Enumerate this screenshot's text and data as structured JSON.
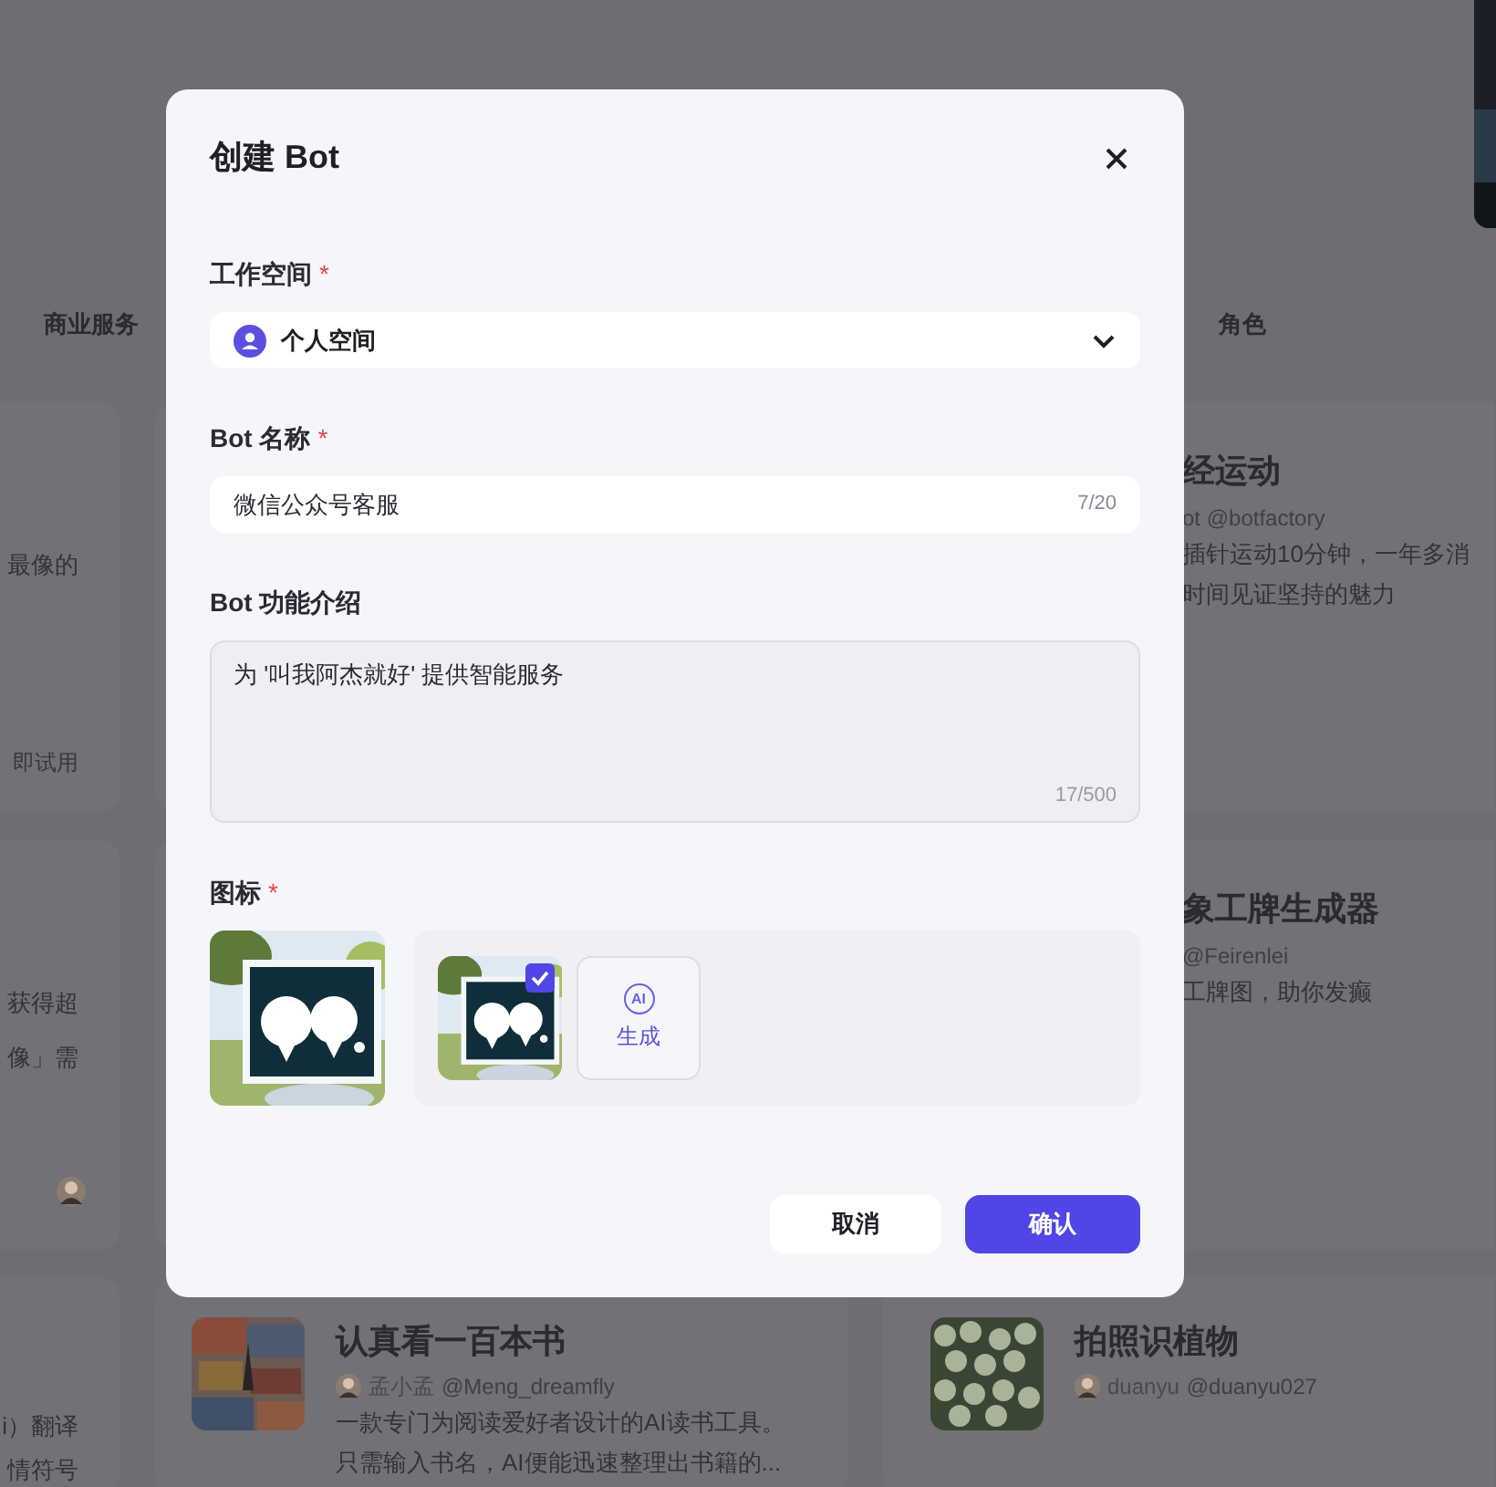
{
  "background": {
    "tabs": [
      {
        "label": "商业服务"
      },
      {
        "label": "角色"
      }
    ],
    "left_cards": [
      {
        "lines": [
          "最像的"
        ],
        "footer": "即试用"
      },
      {
        "lines": [
          "获得超",
          "像」需"
        ],
        "avatar": {
          "kind": "picture"
        }
      },
      {
        "lines": [
          "i）翻译",
          "情符号"
        ]
      }
    ],
    "right_cards": [
      {
        "title": "经运动",
        "author": "ot @botfactory",
        "lines": [
          "插针运动10分钟，一年多消",
          "时间见证坚持的魅力"
        ]
      },
      {
        "title": "象工牌生成器",
        "author": "@Feirenlei",
        "lines": [
          "工牌图，助你发癫"
        ]
      }
    ],
    "bottom_cards": [
      {
        "title": "认真看一百本书",
        "author": "孟小孟",
        "handle": "@Meng_dreamfly",
        "lines": [
          "一款专门为阅读爱好者设计的AI读书工具。",
          "只需输入书名，AI便能迅速整理出书籍的..."
        ]
      },
      {
        "title": "拍照识植物",
        "author": "duanyu",
        "handle": "@duanyu027"
      }
    ]
  },
  "dialog": {
    "title": "创建 Bot",
    "fields": [
      {
        "kind": "select",
        "label": "工作空间",
        "required_mark": "*",
        "value": "个人空间"
      },
      {
        "kind": "input",
        "label": "Bot 名称",
        "required_mark": "*",
        "value": "微信公众号客服",
        "counter": "7/20"
      },
      {
        "kind": "textarea",
        "label": "Bot 功能介绍",
        "value": "为 '叫我阿杰就好' 提供智能服务",
        "counter": "17/500"
      },
      {
        "kind": "icon",
        "label": "图标",
        "required_mark": "*",
        "candidates": [
          {
            "kind": "picture",
            "selected": true
          }
        ],
        "generate_badge": "AI",
        "generate_label": "生成"
      }
    ],
    "buttons": [
      {
        "kind": "secondary",
        "label": "取消"
      },
      {
        "kind": "primary",
        "label": "确认"
      }
    ]
  }
}
